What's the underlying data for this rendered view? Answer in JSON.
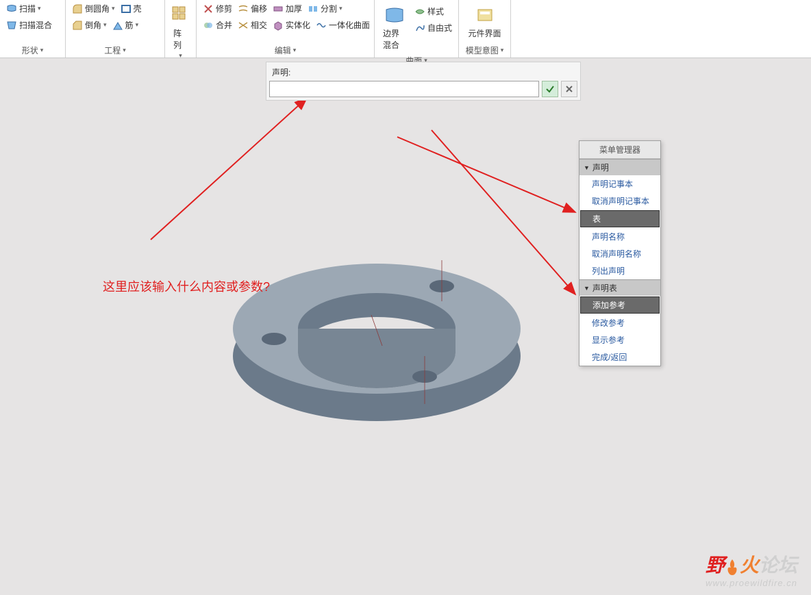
{
  "ribbon": {
    "shape_group": {
      "scan": "扫描",
      "scan_blend": "扫描混合",
      "label": "形状"
    },
    "eng_group": {
      "round": "倒圆角",
      "chamfer": "倒角",
      "shell": "壳",
      "rib": "筋",
      "label": "工程"
    },
    "pattern_group": {
      "pattern": "阵列"
    },
    "edit_group": {
      "trim": "修剪",
      "merge": "合并",
      "offset": "偏移",
      "intersect": "相交",
      "thicken": "加厚",
      "solidify": "实体化",
      "split": "分割",
      "unify": "一体化曲面",
      "label": "编辑"
    },
    "surface_group": {
      "boundary_blend": "边界混合",
      "style": "样式",
      "freestyle": "自由式",
      "label": "曲面"
    },
    "model_group": {
      "component_ui": "元件界面",
      "label": "模型意图"
    }
  },
  "input_bar": {
    "label": "声明:",
    "value": ""
  },
  "question_text": "这里应该输入什么内容或参数?",
  "menu": {
    "title": "菜单管理器",
    "section1": {
      "header": "声明",
      "items": [
        "声明记事本",
        "取消声明记事本",
        "表",
        "声明名称",
        "取消声明名称",
        "列出声明"
      ],
      "selected_index": 2
    },
    "section2": {
      "header": "声明表",
      "items": [
        "添加参考",
        "修改参考",
        "显示参考",
        "完成/返回"
      ],
      "selected_index": 0
    }
  },
  "watermark": {
    "text_a": "野",
    "text_b": "火",
    "text_c": "论坛",
    "url": "www.proewildfire.cn"
  }
}
